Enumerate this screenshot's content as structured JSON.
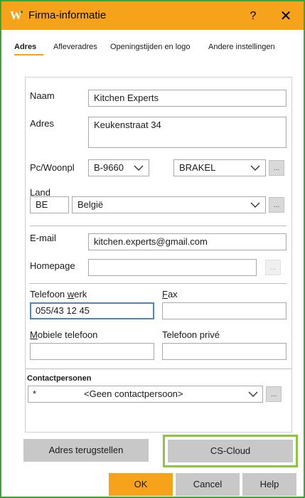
{
  "window": {
    "title": "Firma-informatie",
    "help_glyph": "?",
    "close_glyph": "✕",
    "icon": "w-app-icon"
  },
  "tabs": [
    {
      "label": "Adres",
      "active": true
    },
    {
      "label": "Afleveradres",
      "active": false
    },
    {
      "label": "Openingstijden en logo",
      "active": false
    },
    {
      "label": "Andere instellingen",
      "active": false
    }
  ],
  "form": {
    "naam": {
      "label": "Naam",
      "value": "Kitchen Experts"
    },
    "adres": {
      "label": "Adres",
      "value": "Keukenstraat 34"
    },
    "pc_woonpl": {
      "label": "Pc/Woonpl",
      "postcode": "B-9660",
      "city": "BRAKEL"
    },
    "land": {
      "label": "Land",
      "code": "BE",
      "name": "België"
    },
    "email": {
      "label": "E-mail",
      "value": "kitchen.experts@gmail.com"
    },
    "homepage": {
      "label": "Homepage",
      "value": ""
    },
    "telefoon_werk": {
      "label_pre": "Telefoon ",
      "label_ul": "w",
      "label_post": "erk",
      "value": "055/43 12 45"
    },
    "fax": {
      "label_ul": "F",
      "label_post": "ax",
      "value": ""
    },
    "mobiele_telefoon": {
      "label_ul": "M",
      "label_post": "obiele telefoon",
      "value": ""
    },
    "telefoon_prive": {
      "label": "Telefoon privé",
      "value": ""
    },
    "contactpersonen": {
      "label": "Contactpersonen",
      "marker": "*",
      "value": "<Geen contactpersoon>"
    },
    "dots": "..."
  },
  "buttons": {
    "reset": "Adres terugstellen",
    "cloud": "CS-Cloud",
    "ok": "OK",
    "cancel": "Cancel",
    "help": "Help"
  },
  "colors": {
    "titlebar": "#f7a21b",
    "window_border": "#3aa635",
    "highlight": "#8cc63f",
    "focus": "#4a86c9"
  }
}
